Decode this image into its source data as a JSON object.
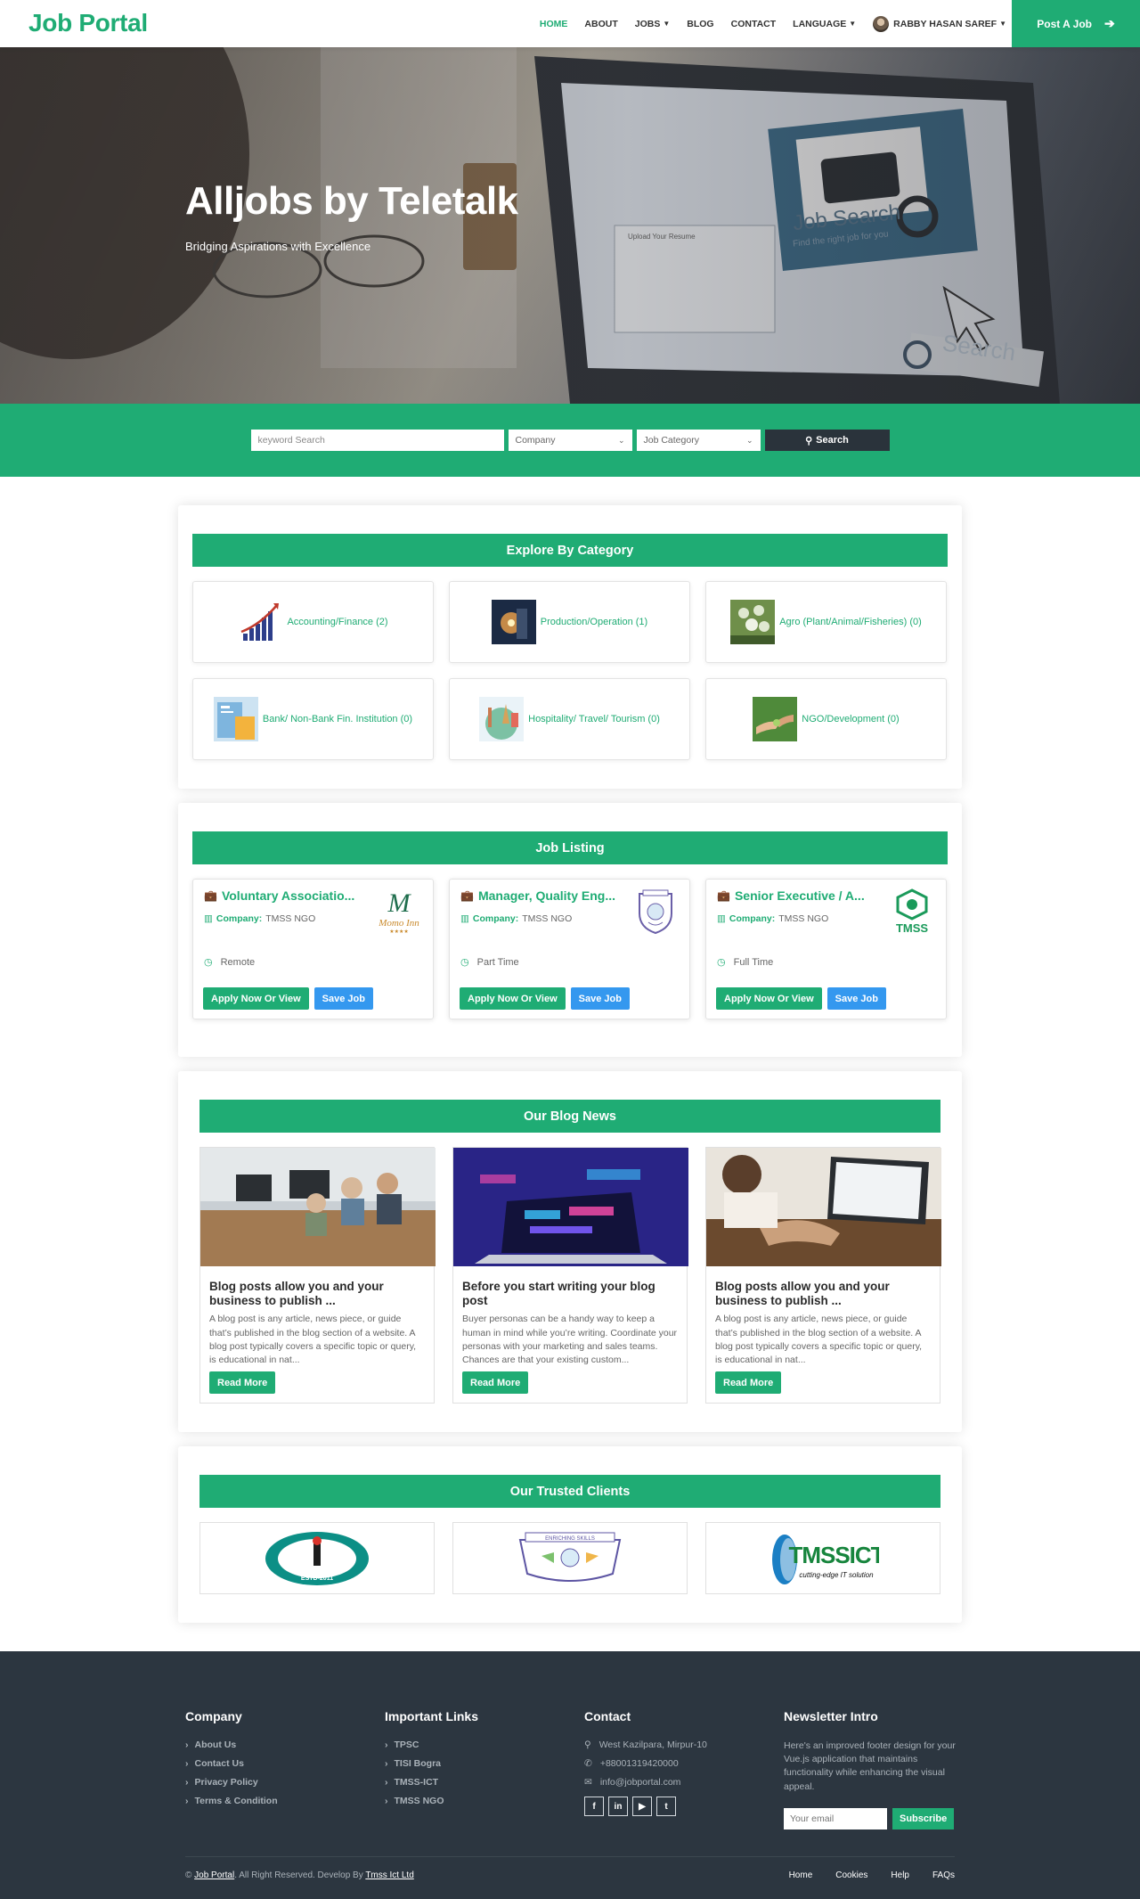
{
  "brand": "Job Portal",
  "nav": {
    "home": "HOME",
    "about": "ABOUT",
    "jobs": "JOBS",
    "blog": "BLOG",
    "contact": "CONTACT",
    "language": "LANGUAGE",
    "user": "RABBY HASAN SAREF",
    "post_job": "Post A Job"
  },
  "hero": {
    "title": "Alljobs by Teletalk",
    "subtitle": "Bridging Aspirations with Excellence",
    "image_text": {
      "job_search": "Job Search",
      "find": "Find the right job for you",
      "search": "Search",
      "upload": "Upload Your Resume"
    }
  },
  "search": {
    "keyword_placeholder": "keyword Search",
    "company": "Company",
    "category": "Job Category",
    "button": "Search"
  },
  "categories": {
    "heading": "Explore By Category",
    "items": [
      {
        "label": "Accounting/Finance (2)"
      },
      {
        "label": "Production/Operation (1)"
      },
      {
        "label": "Agro (Plant/Animal/Fisheries) (0)"
      },
      {
        "label": "Bank/ Non-Bank Fin. Institution (0)"
      },
      {
        "label": "Hospitality/ Travel/ Tourism (0)"
      },
      {
        "label": "NGO/Development (0)"
      }
    ]
  },
  "jobs": {
    "heading": "Job Listing",
    "company_label": "Company:",
    "apply_label": "Apply Now Or View",
    "save_label": "Save Job",
    "items": [
      {
        "title": "Voluntary Associatio...",
        "company": "TMSS NGO",
        "type": "Remote",
        "logo_text": "Momo Inn"
      },
      {
        "title": "Manager, Quality Eng...",
        "company": "TMSS NGO",
        "type": "Part Time",
        "logo_text": ""
      },
      {
        "title": "Senior Executive / A...",
        "company": "TMSS NGO",
        "type": "Full Time",
        "logo_text": "TMSS"
      }
    ]
  },
  "blog": {
    "heading": "Our Blog News",
    "read_more": "Read More",
    "items": [
      {
        "title": "Blog posts allow you and your business to publish ...",
        "text": "A blog post is any article, news piece, or guide that’s published in the blog section of a website. A blog post typically covers a specific topic or query, is educational in nat..."
      },
      {
        "title": "Before you start writing your blog post",
        "text": "Buyer personas can be a handy way to keep a human in mind while you’re writing. Coordinate your personas with your marketing and sales teams. Chances are that your existing custom..."
      },
      {
        "title": "Blog posts allow you and your business to publish ...",
        "text": "A blog post is any article, news piece, or guide that’s published in the blog section of a website. A blog post typically covers a specific topic or query, is educational in nat..."
      }
    ]
  },
  "clients": {
    "heading": "Our Trusted Clients",
    "items": [
      {
        "text": "ESTD-2011"
      },
      {
        "text": "ENRICHING SKILLS"
      },
      {
        "text": "TMSSICT",
        "tagline": "cutting-edge IT solution"
      }
    ]
  },
  "footer": {
    "company": {
      "heading": "Company",
      "links": [
        "About Us",
        "Contact Us",
        "Privacy Policy",
        "Terms & Condition"
      ]
    },
    "important": {
      "heading": "Important Links",
      "links": [
        "TPSC",
        "TISI Bogra",
        "TMSS-ICT",
        "TMSS NGO"
      ]
    },
    "contact": {
      "heading": "Contact",
      "address": "West Kazilpara, Mirpur-10",
      "phone": "+88001319420000",
      "email": "info@jobportal.com"
    },
    "newsletter": {
      "heading": "Newsletter Intro",
      "text": "Here's an improved footer design for your Vue.js application that maintains functionality while enhancing the visual appeal.",
      "placeholder": "Your email",
      "button": "Subscribe"
    },
    "copyright": {
      "prefix": "©",
      "brand": "Job Portal",
      "middle": ". All Right Reserved. Develop By",
      "developer": "Tmss Ict Ltd"
    },
    "bottom_links": [
      "Home",
      "Cookies",
      "Help",
      "FAQs"
    ]
  },
  "colors": {
    "accent": "#1fac74",
    "dark": "#2c3640",
    "save": "#3498ef"
  }
}
